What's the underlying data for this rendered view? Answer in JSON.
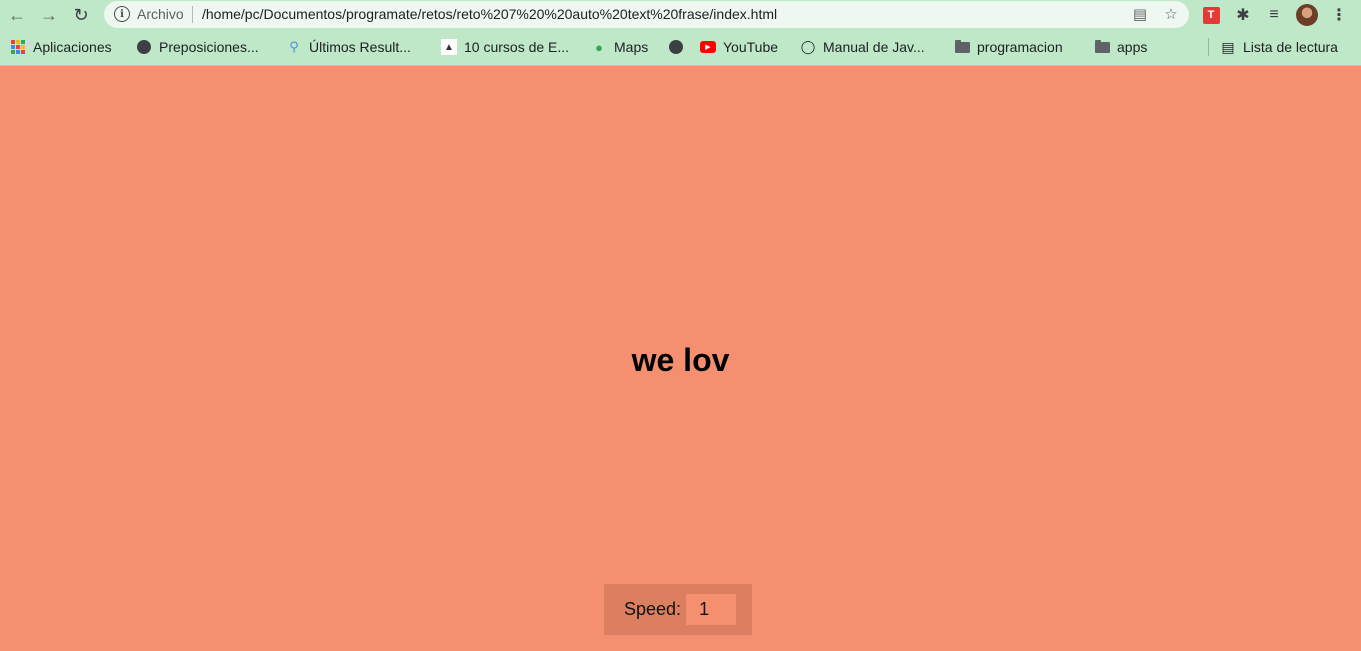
{
  "browser": {
    "address_bar": {
      "security_label": "Archivo",
      "url": "/home/pc/Documentos/programate/retos/reto%207%20%20auto%20text%20frase/index.html"
    },
    "bookmarks": [
      {
        "label": "Aplicaciones",
        "icon": "apps-grid-icon"
      },
      {
        "label": "Preposiciones...",
        "icon": "globe-icon"
      },
      {
        "label": "Últimos Result...",
        "icon": "idea-icon"
      },
      {
        "label": "10 cursos de E...",
        "icon": "course-icon"
      },
      {
        "label": "Maps",
        "icon": "maps-pin-icon"
      },
      {
        "label": "",
        "icon": "globe-icon"
      },
      {
        "label": "YouTube",
        "icon": "youtube-icon"
      },
      {
        "label": "Manual de Jav...",
        "icon": "java-icon"
      },
      {
        "label": "programacion",
        "icon": "folder-icon"
      },
      {
        "label": "apps",
        "icon": "folder-icon"
      }
    ],
    "reading_list": {
      "label": "Lista de lectura",
      "icon": "reading-list-icon"
    },
    "extension_badge": "T"
  },
  "page": {
    "phrase": "we lov",
    "speed": {
      "label": "Speed:",
      "value": "1"
    }
  },
  "colors": {
    "page_background": "#f4906f",
    "speed_box_background": "#dc7f61",
    "chrome_background": "#bfe8c9"
  }
}
